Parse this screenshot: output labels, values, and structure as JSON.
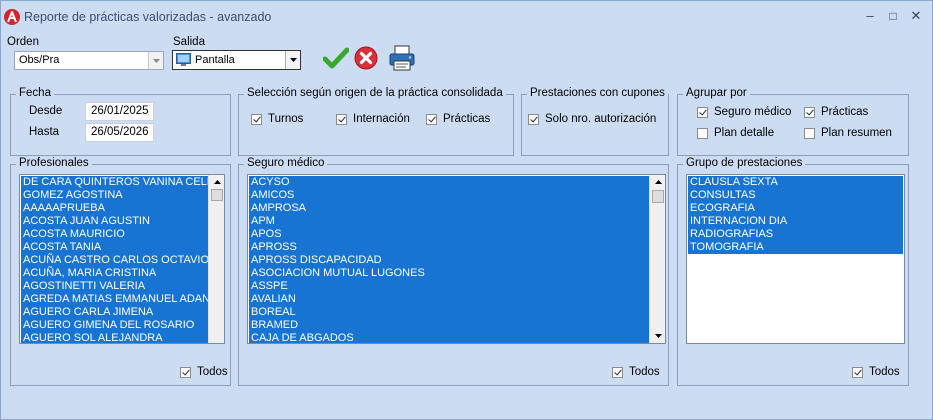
{
  "window": {
    "title": "Reporte de prácticas valorizadas - avanzado",
    "controls": {
      "minimize": "–",
      "maximize": "□",
      "close": "✕"
    }
  },
  "toolbar": {
    "orden_label": "Orden",
    "orden_value": "Obs/Pra",
    "salida_label": "Salida",
    "salida_value": "Pantalla"
  },
  "fecha": {
    "title": "Fecha",
    "desde_label": "Desde",
    "desde_value": "26/01/2025",
    "hasta_label": "Hasta",
    "hasta_value": "26/05/2026"
  },
  "seleccion": {
    "title": "Selección según origen de la práctica consolidada",
    "options": [
      {
        "label": "Turnos",
        "checked": true
      },
      {
        "label": "Internación",
        "checked": true
      },
      {
        "label": "Prácticas",
        "checked": true
      }
    ]
  },
  "cupones": {
    "title": "Prestaciones con cupones",
    "option": {
      "label": "Solo nro. autorización",
      "checked": true
    }
  },
  "agrupar": {
    "title": "Agrupar por",
    "options": [
      {
        "label": "Seguro médico",
        "checked": true
      },
      {
        "label": "Prácticas",
        "checked": true
      },
      {
        "label": "Plan detalle",
        "checked": false
      },
      {
        "label": "Plan resumen",
        "checked": false
      }
    ]
  },
  "profesionales": {
    "title": "Profesionales",
    "items": [
      "DE CARA QUINTEROS VANINA CELE",
      "GOMEZ AGOSTINA",
      "AAAAAPRUEBA",
      "ACOSTA JUAN AGUSTIN",
      "ACOSTA MAURICIO",
      "ACOSTA TANIA",
      "ACUÑA CASTRO CARLOS OCTAVIO",
      "ACUÑA, MARIA CRISTINA",
      "AGOSTINETTI VALERIA",
      "AGREDA MATIAS EMMANUEL ADAN",
      "AGUERO CARLA JIMENA",
      "AGUERO GIMENA DEL ROSARIO",
      "AGUERO SOL ALEJANDRA"
    ],
    "todos_label": "Todos",
    "todos_checked": true
  },
  "seguro": {
    "title": "Seguro médico",
    "items": [
      "ACYSO",
      "AMICOS",
      "AMPROSA",
      "APM",
      "APOS",
      "APROSS",
      "APROSS DISCAPACIDAD",
      "ASOCIACION MUTUAL LUGONES",
      "ASSPE",
      "AVALIAN",
      "BOREAL",
      "BRAMED",
      "CAJA DE ABGADOS"
    ],
    "todos_label": "Todos",
    "todos_checked": true
  },
  "grupo": {
    "title": "Grupo de prestaciones",
    "items": [
      "CLAUSLA SEXTA",
      "CONSULTAS",
      "ECOGRAFIA",
      "INTERNACION DIA",
      "RADIOGRAFIAS",
      "TOMOGRAFIA"
    ],
    "todos_label": "Todos",
    "todos_checked": true
  },
  "icons": {
    "app": "app-logo-icon",
    "accept": "checkmark-icon",
    "cancel": "cancel-icon",
    "print": "printer-icon",
    "monitor": "monitor-icon"
  },
  "colors": {
    "window_bg": "#cbdcf3",
    "selection": "#1874d2",
    "accept": "#3aa830",
    "cancel": "#d9313a"
  }
}
